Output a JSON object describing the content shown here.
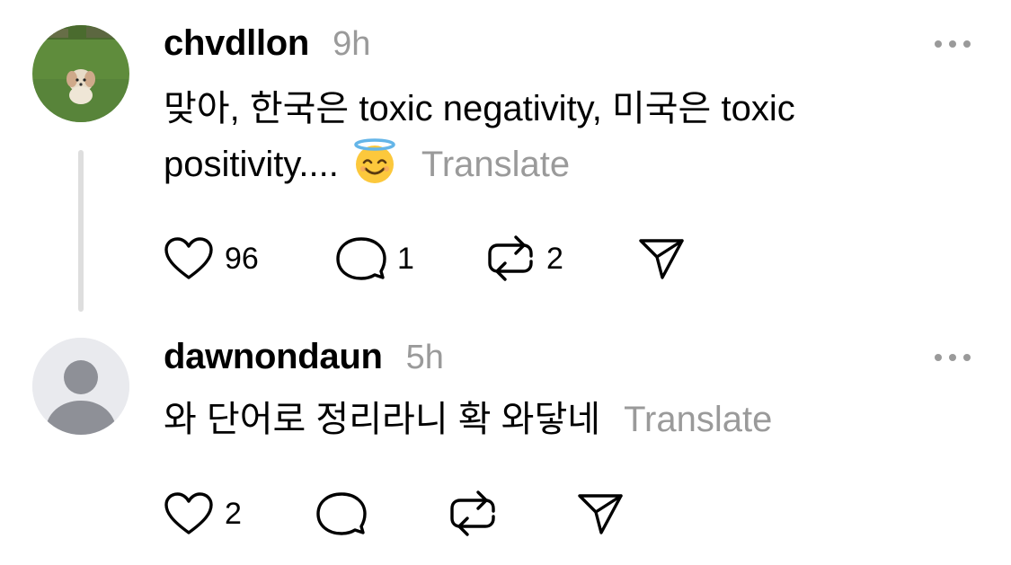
{
  "posts": [
    {
      "username": "chvdllon",
      "time": "9h",
      "text": "맞아, 한국은 toxic negativity, 미국은 toxic positivity....",
      "translate": "Translate",
      "likes": "96",
      "replies": "1",
      "reposts": "2",
      "emoji": "smiling-face-with-halo-icon"
    },
    {
      "username": "dawnondaun",
      "time": "5h",
      "text": "와 단어로 정리라니 확 와닿네",
      "translate": "Translate",
      "likes": "2"
    }
  ],
  "icons": [
    "heart-icon",
    "comment-icon",
    "repost-icon",
    "share-icon",
    "more-icon"
  ],
  "colors": {
    "muted": "#9a9a9a",
    "text": "#000000",
    "thread_line": "#dedede",
    "avatar_placeholder": "#8e9097"
  }
}
